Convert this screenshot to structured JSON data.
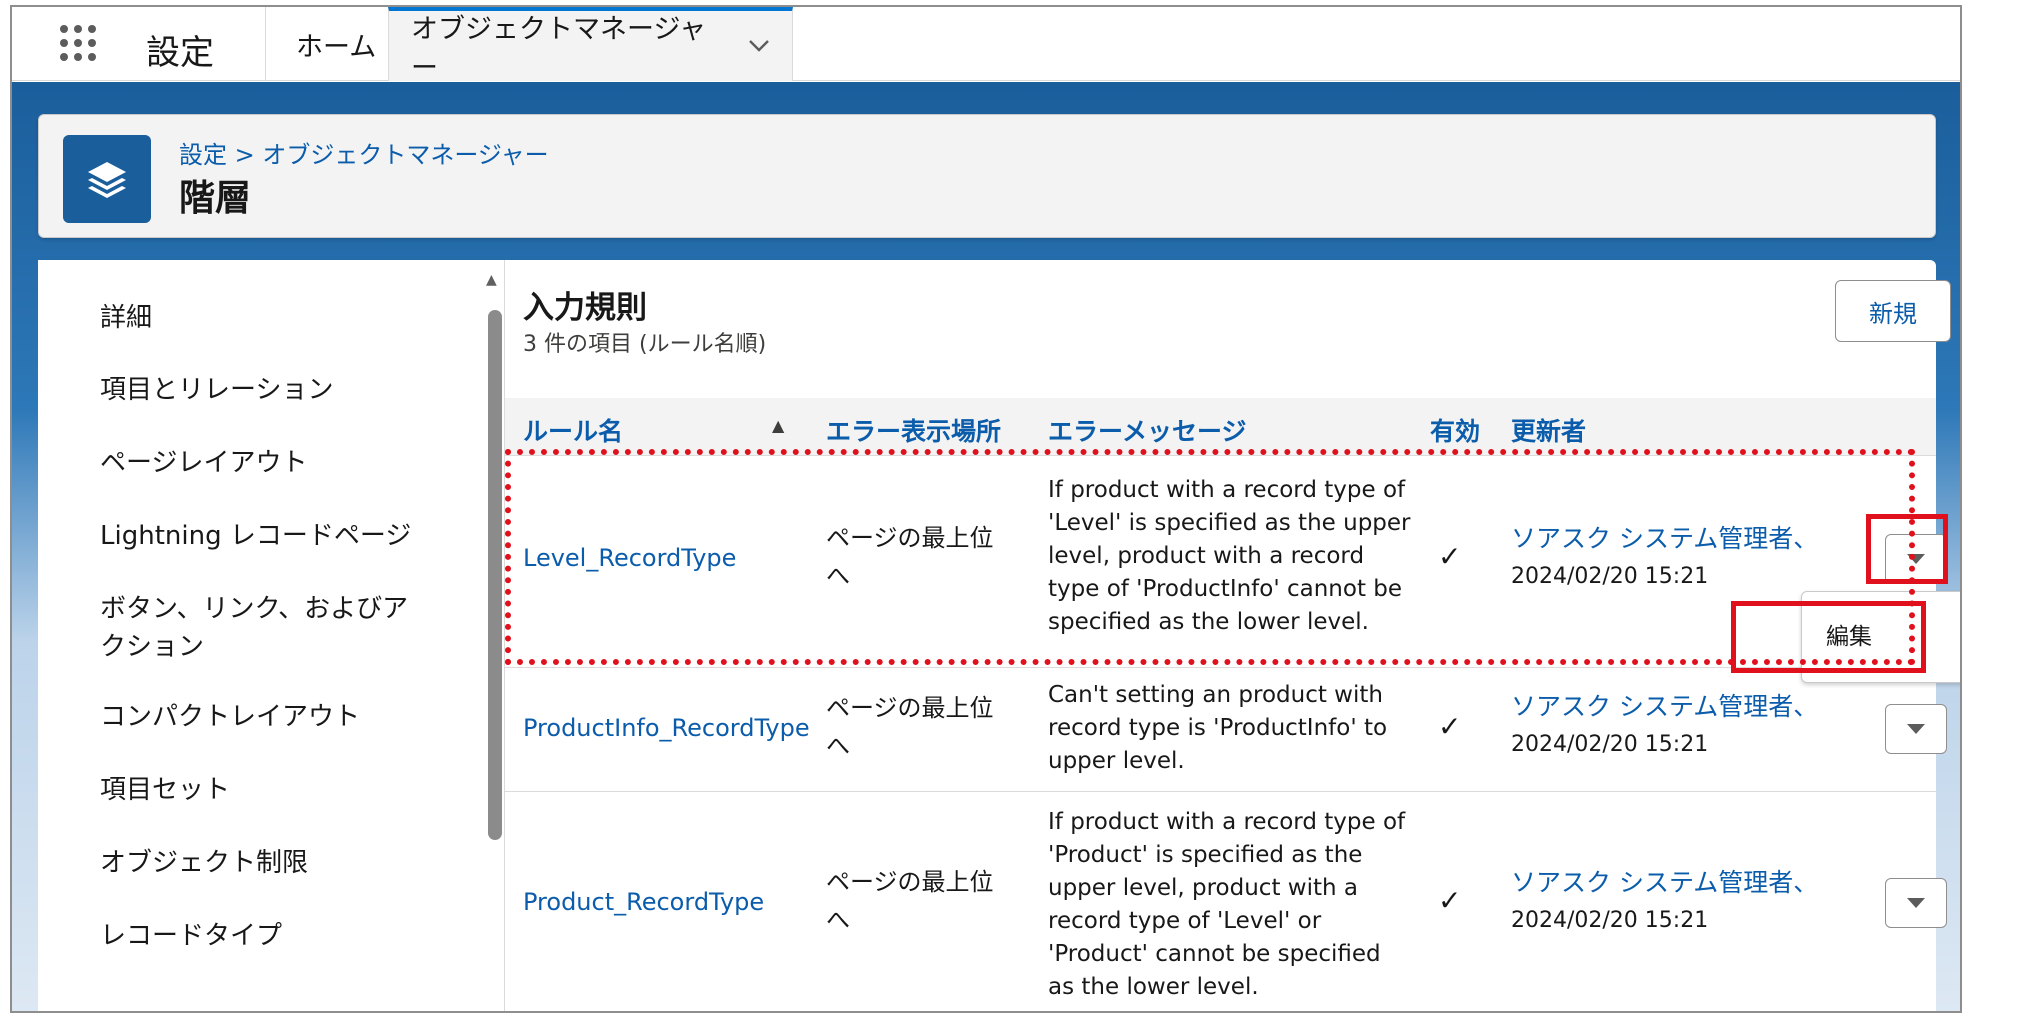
{
  "topbar": {
    "app_name": "設定",
    "tabs": [
      {
        "label": "ホーム"
      },
      {
        "label": "オブジェクトマネージャー"
      }
    ]
  },
  "header": {
    "breadcrumb": "設定 > オブジェクトマネージャー",
    "title": "階層"
  },
  "sidebar": {
    "items": [
      {
        "label": "詳細"
      },
      {
        "label": "項目とリレーション"
      },
      {
        "label": "ページレイアウト"
      },
      {
        "label": "Lightning レコードページ"
      },
      {
        "label": "ボタン、リンク、およびア"
      },
      {
        "label": "クション"
      },
      {
        "label": "コンパクトレイアウト"
      },
      {
        "label": "項目セット"
      },
      {
        "label": "オブジェクト制限"
      },
      {
        "label": "レコードタイプ"
      }
    ]
  },
  "section": {
    "title": "入力規則",
    "subtitle": "3 件の項目 (ルール名順)",
    "new_button": "新規"
  },
  "table": {
    "headers": {
      "rule_name": "ルール名",
      "location": "エラー表示場所",
      "message": "エラーメッセージ",
      "active": "有効",
      "modified_by": "更新者"
    },
    "rows": [
      {
        "rule_name": "Level_RecordType",
        "location_1": "ページの最上位",
        "location_2": "へ",
        "message_lines": [
          "If product with a record type of",
          "'Level' is specified as the upper",
          "level, product with a record",
          "type of 'ProductInfo' cannot be",
          "specified as the lower level."
        ],
        "active": "✓",
        "modified_by": "ソアスク システム管理者、",
        "modified_date": "2024/02/20 15:21"
      },
      {
        "rule_name": "ProductInfo_RecordType",
        "location_1": "ページの最上位",
        "location_2": "へ",
        "message_lines": [
          "Can't setting an product with",
          "record type is 'ProductInfo' to",
          "upper level."
        ],
        "active": "✓",
        "modified_by": "ソアスク システム管理者、",
        "modified_date": "2024/02/20 15:21"
      },
      {
        "rule_name": "Product_RecordType",
        "location_1": "ページの最上位",
        "location_2": "へ",
        "message_lines": [
          "If product with a record type of",
          "'Product' is specified as the",
          "upper level, product with a",
          "record type of 'Level' or",
          "'Product' cannot be specified",
          "as the lower level."
        ],
        "active": "✓",
        "modified_by": "ソアスク システム管理者、",
        "modified_date": "2024/02/20 15:21"
      }
    ]
  },
  "dropdown": {
    "edit_label": "編集"
  },
  "colors": {
    "brand": "#0176d3",
    "link": "#0b5cab",
    "annotation_red": "#e0101c",
    "header_icon": "#1b5e9c"
  }
}
